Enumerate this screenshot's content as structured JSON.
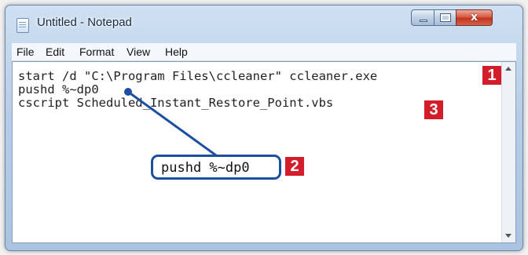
{
  "window": {
    "title": "Untitled - Notepad",
    "icon": "notepad-icon",
    "controls": {
      "minimize": "minimize-icon",
      "maximize": "maximize-icon",
      "close_label": "x"
    }
  },
  "menu": {
    "items": [
      "File",
      "Edit",
      "Format",
      "View",
      "Help"
    ]
  },
  "editor": {
    "lines": [
      "start /d \"C:\\Program Files\\ccleaner\" ccleaner.exe",
      "pushd %~dp0",
      "cscript Scheduled_Instant_Restore_Point.vbs"
    ]
  },
  "callout": {
    "text": "pushd %~dp0"
  },
  "badges": {
    "one": "1",
    "two": "2",
    "three": "3"
  },
  "colors": {
    "badge": "#d41d2b",
    "callout": "#1d4fa0"
  }
}
